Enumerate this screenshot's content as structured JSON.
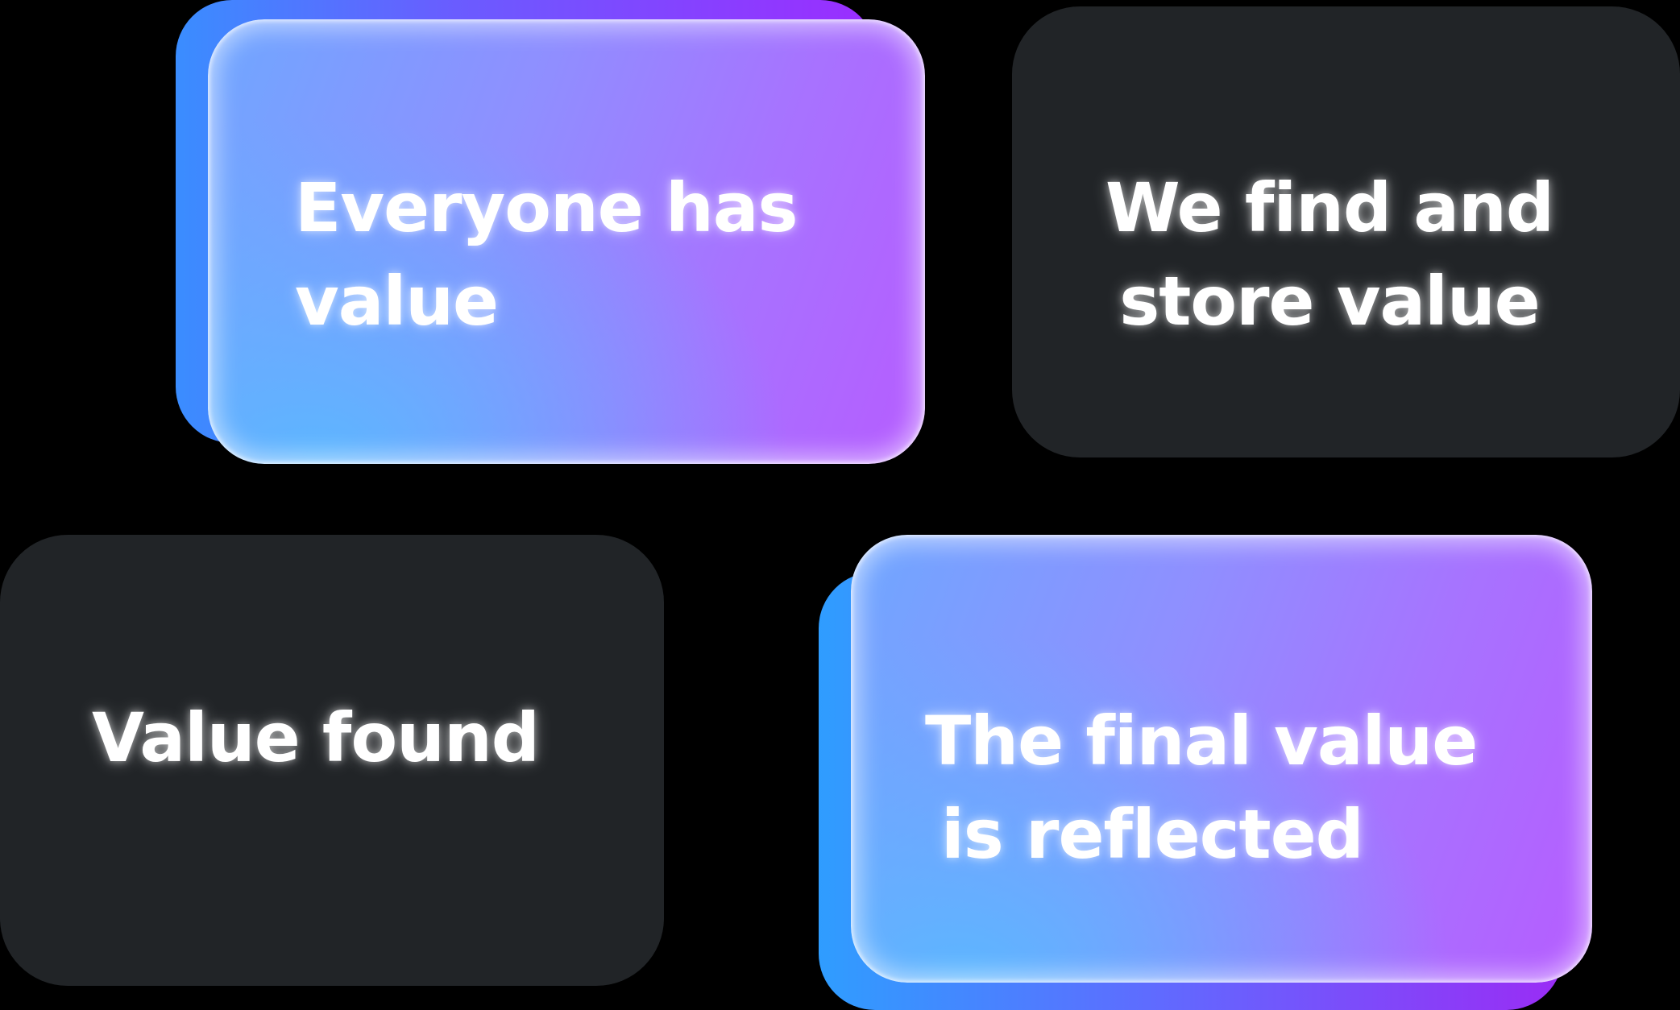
{
  "cards": {
    "card1": {
      "line1": "Everyone has",
      "line2": "value"
    },
    "card2": {
      "line1": "We find and",
      "line2": "store value"
    },
    "card3": {
      "line1": "Value found"
    },
    "card4": {
      "line1": "The final value",
      "line2": "is reflected"
    }
  },
  "colors": {
    "background": "#000000",
    "dark_card": "#212427",
    "gradient_start": "#5cb6ff",
    "gradient_end": "#b65cff",
    "text": "#ffffff"
  }
}
